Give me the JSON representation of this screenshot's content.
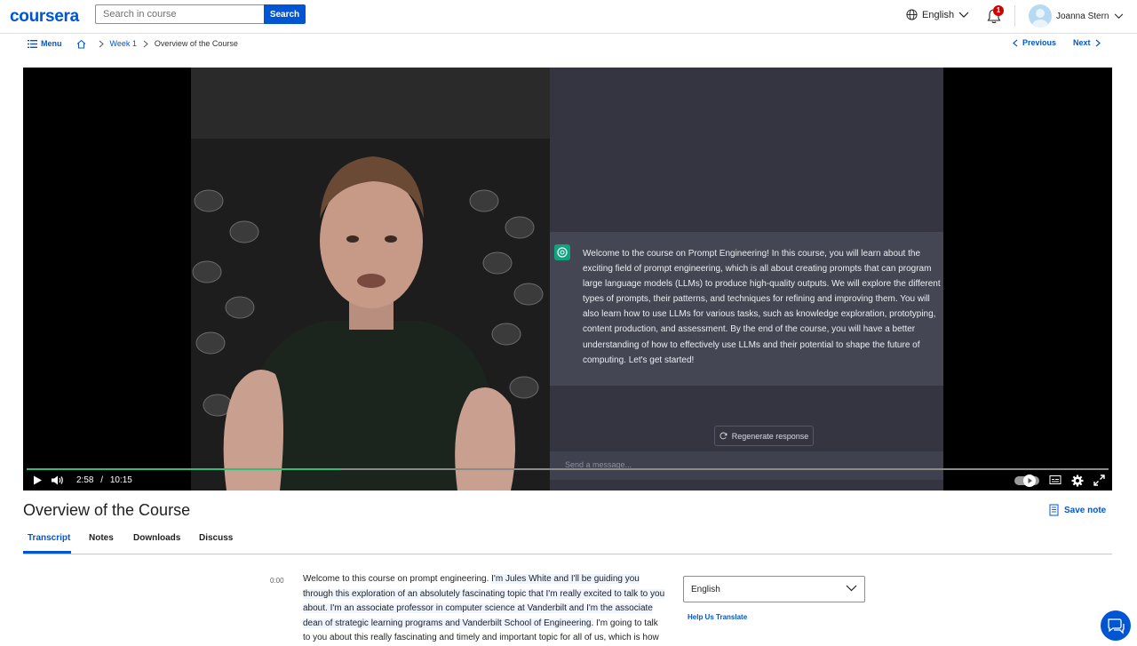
{
  "header": {
    "logo": "coursera",
    "search": {
      "placeholder": "Search in course",
      "button_label": "Search"
    },
    "language": "English",
    "notifications_count": "1",
    "user_name": "Joanna Stern"
  },
  "breadcrumb": {
    "menu_label": "Menu",
    "items": [
      "Week 1",
      "Overview of the Course"
    ],
    "previous_label": "Previous",
    "next_label": "Next"
  },
  "video": {
    "chat_message": "Welcome to the course on Prompt Engineering! In this course, you will learn about the exciting field of prompt engineering, which is all about creating prompts that can program large language models (LLMs) to produce high-quality outputs. We will explore the different types of prompts, their patterns, and techniques for refining and improving them. You will also learn how to use LLMs for various tasks, such as knowledge exploration, prototyping, content production, and assessment. By the end of the course, you will have a better understanding of how to effectively use LLMs and their potential to shape the future of computing. Let's get started!",
    "regenerate_label": "Regenerate response",
    "send_placeholder": "Send a message...",
    "current_time": "2:58",
    "time_separator": "/",
    "duration": "10:15",
    "progress_fraction": 0.29
  },
  "page": {
    "title": "Overview of the Course",
    "save_note_label": "Save note"
  },
  "tabs": [
    {
      "label": "Transcript",
      "active": true
    },
    {
      "label": "Notes",
      "active": false
    },
    {
      "label": "Downloads",
      "active": false
    },
    {
      "label": "Discuss",
      "active": false
    }
  ],
  "transcript": {
    "timestamp": "0:00",
    "segment_1": "Welcome to this course on prompt engineering. ",
    "segment_2_highlighted": "I'm Jules White and I'll be guiding you through this exploration of an absolutely fascinating topic that I'm really excited to talk to you about. I'm an associate professor in computer science at Vanderbilt and I'm the associate dean of strategic learning programs and Vanderbilt School of Engineering.",
    "segment_3": " I'm going to talk to you about this really fascinating and timely and important topic for all of us, which is how do we interact with",
    "language_select": "English",
    "help_translate_label": "Help Us Translate"
  },
  "colors": {
    "brand_blue": "#0056d2",
    "progress_green": "#2ebd75",
    "chat_bg": "#343541",
    "chat_msg_bg": "#444654",
    "notification_red": "#d30001"
  }
}
